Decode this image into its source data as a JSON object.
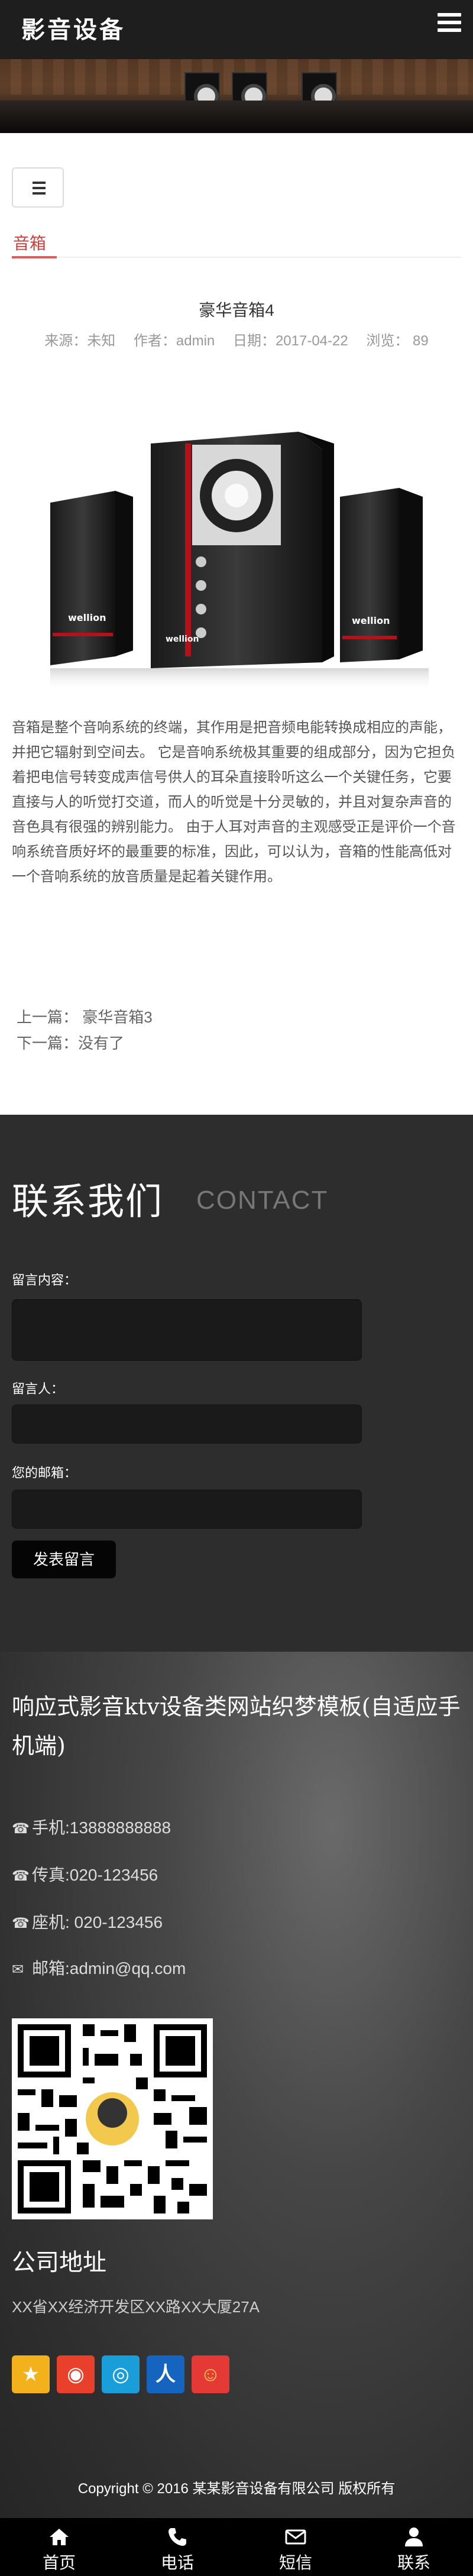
{
  "header": {
    "logo": "影音设备",
    "menu_icon": "menu-icon"
  },
  "category": {
    "button_icon": "list-icon",
    "breadcrumb": "音箱"
  },
  "article": {
    "title": "豪华音箱4",
    "meta": {
      "source": "来源：未知",
      "author": "作者：admin",
      "date": "日期：2017-04-22",
      "views": "浏览： 89"
    },
    "body": "音箱是整个音响系统的终端，其作用是把音频电能转换成相应的声能，并把它辐射到空间去。 它是音响系统极其重要的组成部分，因为它担负着把电信号转变成声信号供人的耳朵直接聆听这么一个关键任务，它要直接与人的听觉打交道，而人的听觉是十分灵敏的，并且对复杂声音的音色具有很强的辨别能力。 由于人耳对声音的主观感受正是评价一个音响系统音质好坏的最重要的标准，因此，可以认为，音箱的性能高低对一个音响系统的放音质量是起着关键作用。",
    "product_brand": "wellion",
    "prev": "上一篇：  豪华音箱3",
    "next": "下一篇：没有了"
  },
  "contact": {
    "title": "联系我们",
    "title_en": "CONTACT",
    "message_label": "留言内容：",
    "name_label": "留言人：",
    "email_label": "您的邮箱：",
    "submit_label": "发表留言"
  },
  "info": {
    "site_name": "响应式影音ktv设备类网站织梦模板(自适应手机端)",
    "mobile": "手机:13888888888",
    "fax": "传真:020-123456",
    "phone": "座机: 020-123456",
    "email": "邮箱:admin@qq.com",
    "address_title": "公司地址",
    "address": "XX省XX经济开发区XX路XX大厦27A",
    "share_icons": [
      "qzone-icon",
      "weibo-icon",
      "tencent-weibo-icon",
      "renren-icon",
      "kaixin-icon"
    ],
    "copyright": "Copyright © 2016 某某影音设备有限公司 版权所有"
  },
  "bottom_nav": [
    {
      "label": "首页",
      "icon": "home-icon"
    },
    {
      "label": "电话",
      "icon": "phone-icon"
    },
    {
      "label": "短信",
      "icon": "mail-icon"
    },
    {
      "label": "联系",
      "icon": "user-icon"
    }
  ],
  "colors": {
    "accent": "#e65a5a",
    "dark": "#1e1e1e",
    "contact_bg": "#2d2d2d"
  }
}
